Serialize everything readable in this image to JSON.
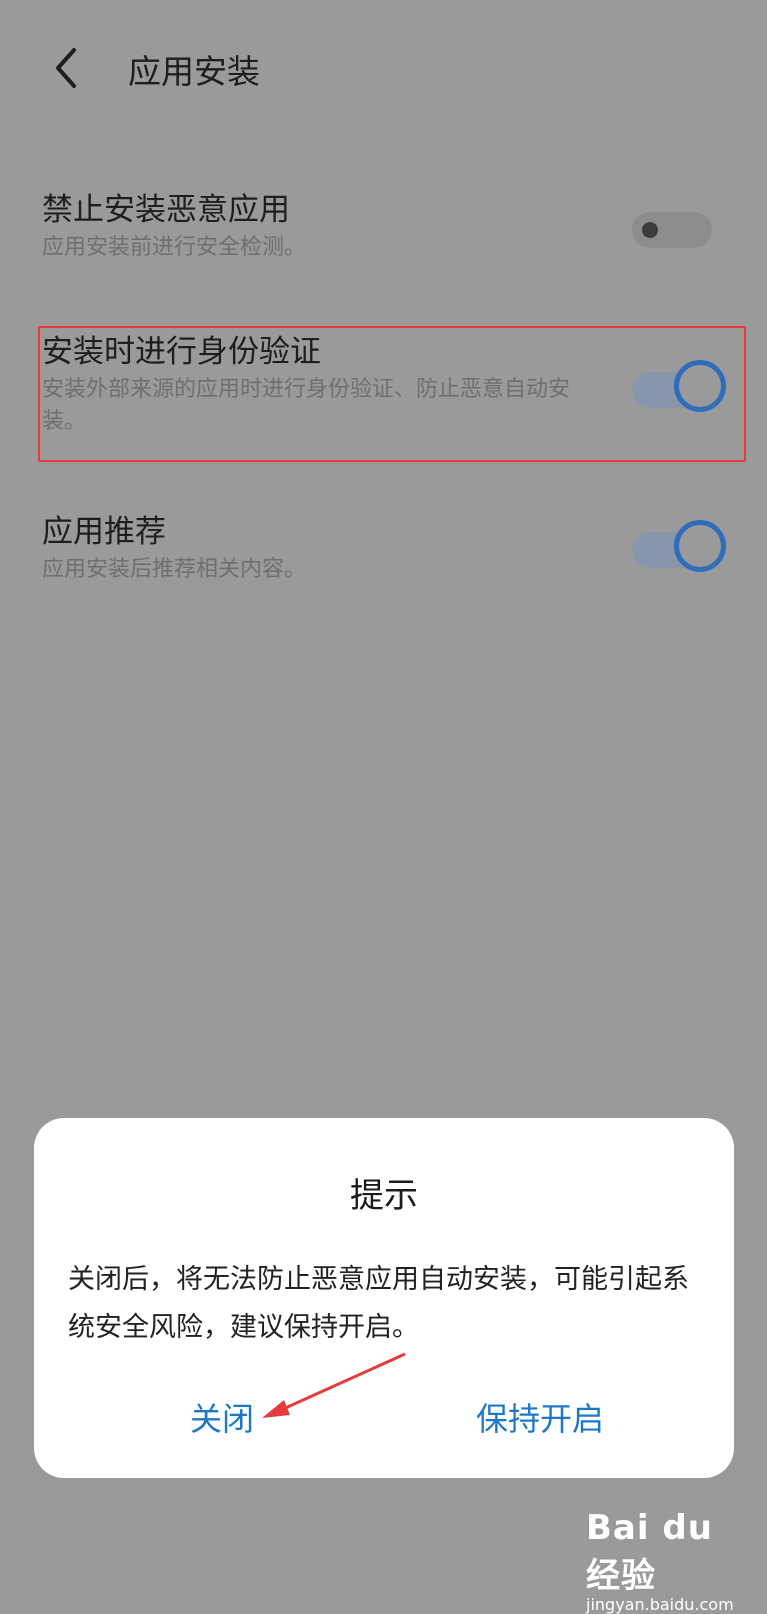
{
  "header": {
    "title": "应用安装",
    "back_icon": "chevron-left-icon"
  },
  "settings": [
    {
      "title": "禁止安装恶意应用",
      "desc": "应用安装前进行安全检测。",
      "enabled": false
    },
    {
      "title": "安装时进行身份验证",
      "desc": "安装外部来源的应用时进行身份验证、防止恶意自动安装。",
      "enabled": true
    },
    {
      "title": "应用推荐",
      "desc": "应用安装后推荐相关内容。",
      "enabled": true
    }
  ],
  "dialog": {
    "title": "提示",
    "message": "关闭后，将无法防止恶意应用自动安装，可能引起系统安全风险，建议保持开启。",
    "close_label": "关闭",
    "keep_label": "保持开启"
  },
  "watermark": {
    "logo": "Bai du 经验",
    "url": "jingyan.baidu.com"
  },
  "colors": {
    "accent": "#1d79c7",
    "highlight": "#e83a3a",
    "overlay": "#9a9a9a"
  }
}
